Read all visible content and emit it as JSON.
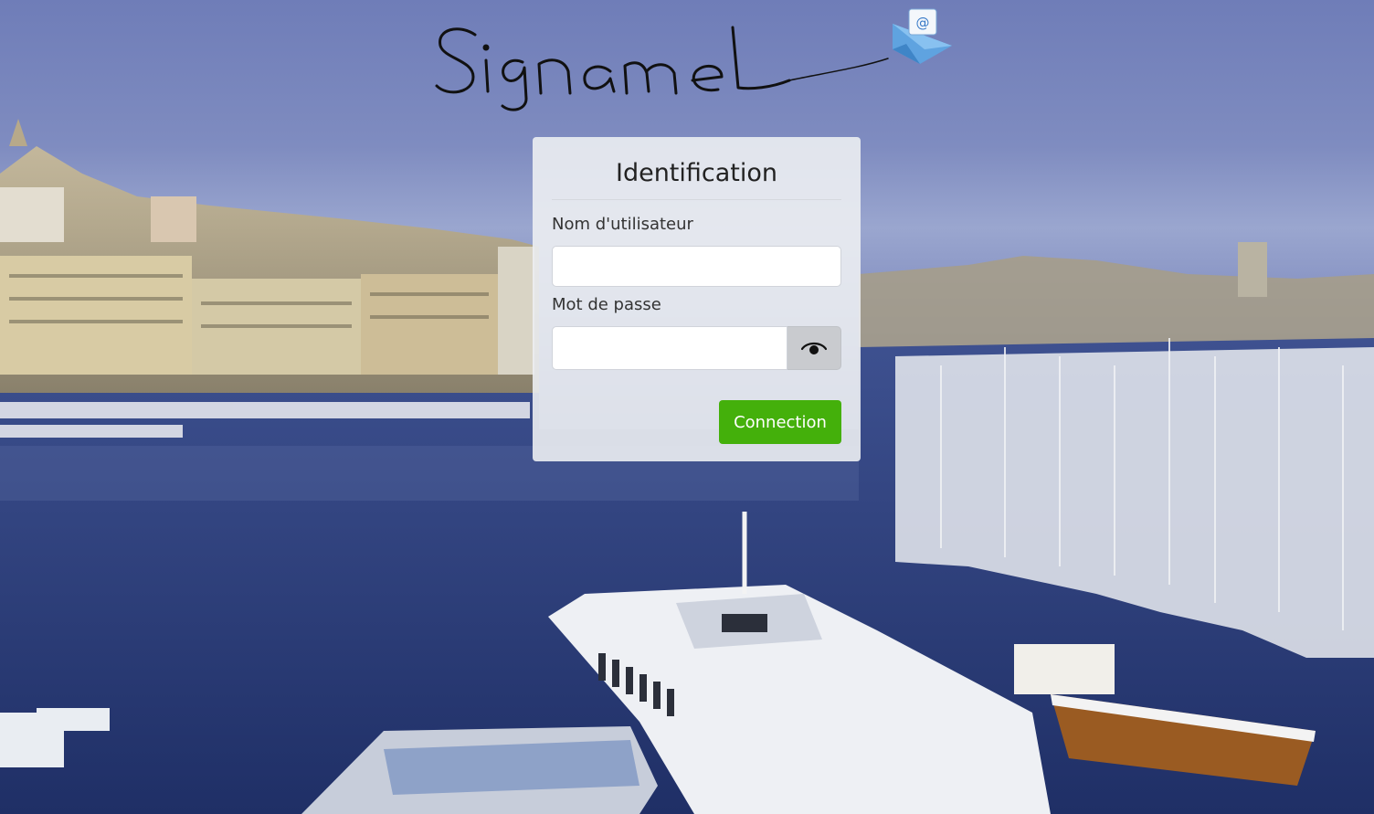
{
  "app": {
    "logo_text": "Signamel",
    "logo_icon": "envelope-at-icon"
  },
  "login": {
    "title": "Identification",
    "username_label": "Nom d'utilisateur",
    "username_value": "",
    "password_label": "Mot de passe",
    "password_value": "",
    "toggle_icon": "eye-icon",
    "submit_label": "Connection"
  },
  "colors": {
    "submit_button": "#44b00b",
    "panel_background": "#eceef2",
    "title_text": "#222222"
  }
}
